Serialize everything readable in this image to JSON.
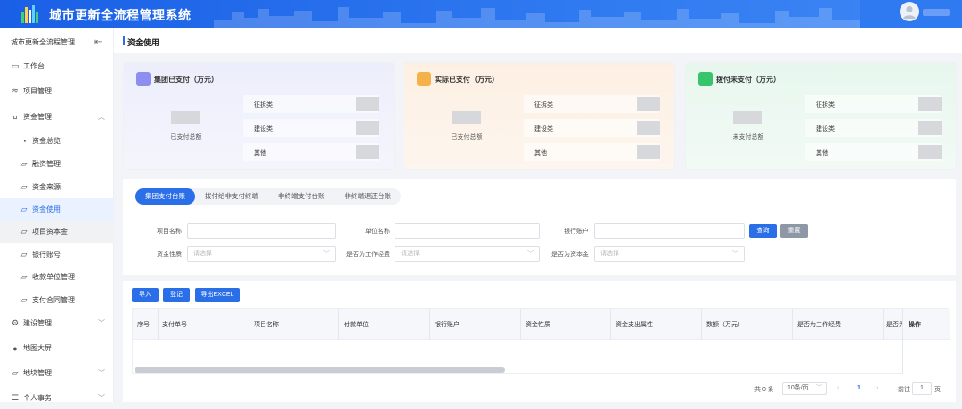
{
  "header": {
    "title": "城市更新全流程管理系统"
  },
  "sidebar": {
    "top_label": "城市更新全流程管理",
    "collapse_icon": "indent-icon",
    "items": [
      {
        "label": "工作台",
        "icon": "monitor-icon"
      },
      {
        "label": "项目管理",
        "icon": "layers-icon"
      },
      {
        "label": "资金管理",
        "icon": "money-icon",
        "expanded": true
      },
      {
        "label": "资金总览",
        "icon": "clock-icon"
      },
      {
        "label": "融资管理",
        "icon": "folder-icon"
      },
      {
        "label": "资金来源",
        "icon": "folder-icon"
      },
      {
        "label": "资金使用",
        "icon": "folder-icon",
        "active": true
      },
      {
        "label": "项目资本金",
        "icon": "folder-icon"
      },
      {
        "label": "银行账号",
        "icon": "folder-icon"
      },
      {
        "label": "收款单位管理",
        "icon": "folder-icon"
      },
      {
        "label": "支付合同管理",
        "icon": "folder-icon"
      },
      {
        "label": "建设管理",
        "icon": "gear-icon"
      },
      {
        "label": "地图大屏",
        "icon": "globe-icon"
      },
      {
        "label": "地块管理",
        "icon": "folder-icon"
      },
      {
        "label": "个人事务",
        "icon": "list-icon"
      }
    ]
  },
  "breadcrumb": "资金使用",
  "cards": [
    {
      "title": "集团已支付（万元）",
      "total_label": "已支付总额",
      "rows": [
        "征拆类",
        "建设类",
        "其他"
      ]
    },
    {
      "title": "实际已支付（万元）",
      "total_label": "已支付总额",
      "rows": [
        "征拆类",
        "建设类",
        "其他"
      ]
    },
    {
      "title": "拨付未支付（万元）",
      "total_label": "未支付总额",
      "rows": [
        "征拆类",
        "建设类",
        "其他"
      ]
    }
  ],
  "tabs": [
    "集团支付台账",
    "拨付给非支付终端",
    "非终端支付台账",
    "非终端退还台账"
  ],
  "filters": {
    "project_name": "项目名称",
    "unit_name": "单位名称",
    "bank_account": "银行账户",
    "fund_nature": "资金性质",
    "is_work_fund": "是否为工作经费",
    "is_capital": "是否为资本金",
    "select_placeholder": "请选择",
    "search_btn": "查询",
    "reset_btn": "重置"
  },
  "actions": {
    "import": "导入",
    "register": "登记",
    "export": "导出EXCEL"
  },
  "table": {
    "columns": [
      "序号",
      "支付单号",
      "项目名称",
      "付款单位",
      "银行账户",
      "资金性质",
      "资金支出属性",
      "数额（万元）",
      "是否为工作经费",
      "是否为"
    ],
    "op_column": "操作"
  },
  "pager": {
    "total": "共 0 条",
    "page_size": "10条/页",
    "current": "1",
    "goto_prefix": "前往",
    "goto_value": "1",
    "goto_suffix": "页"
  }
}
